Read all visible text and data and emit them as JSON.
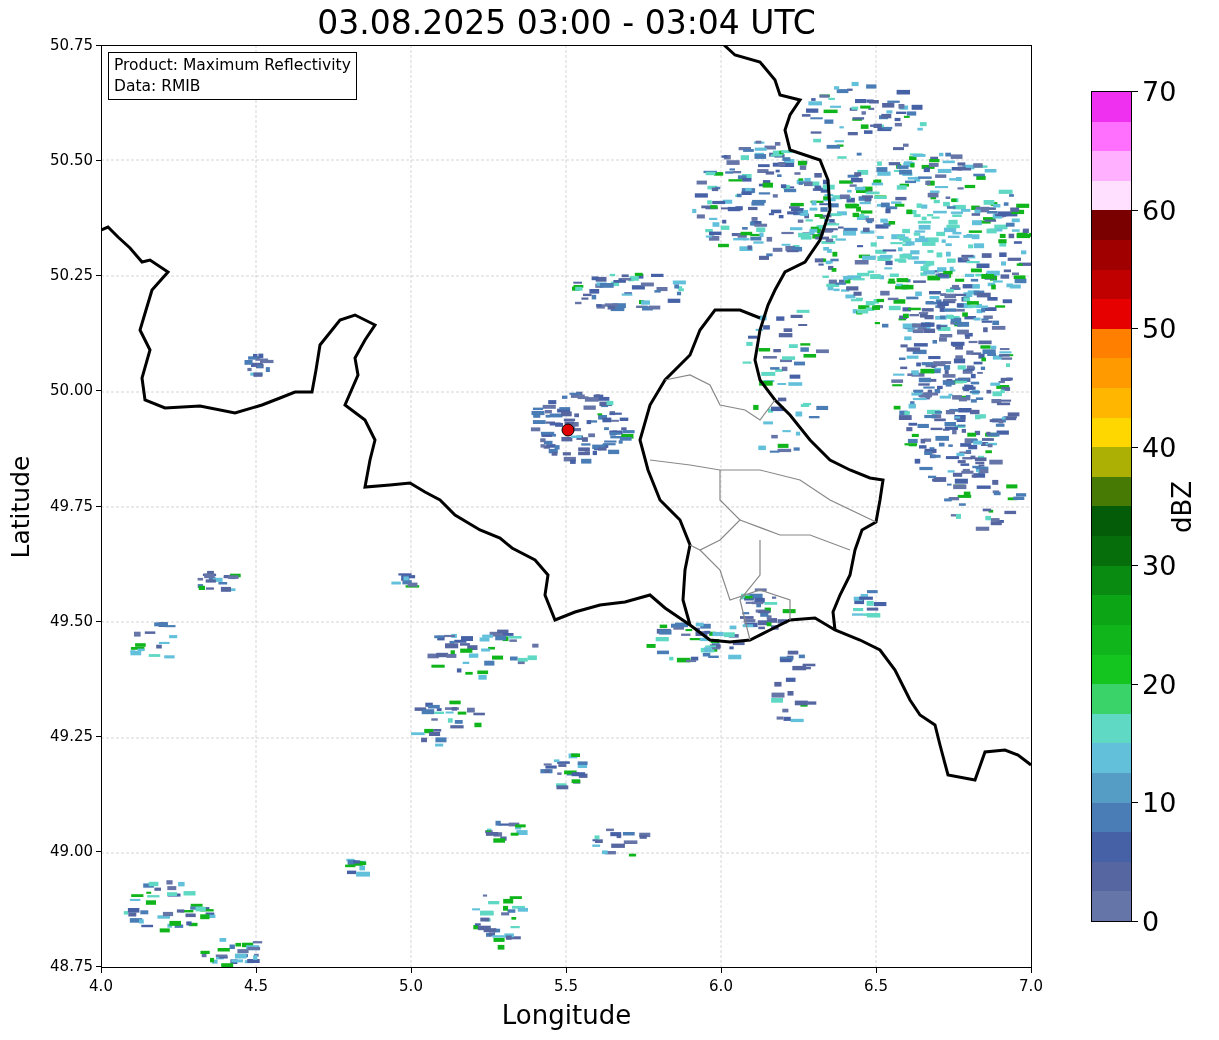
{
  "title": "03.08.2025 03:00 - 03:04 UTC",
  "info_box": {
    "lines": [
      "Product: Maximum Reflectivity",
      "Data: RMIB"
    ]
  },
  "map": {
    "x_axis": {
      "label": "Longitude",
      "ticks": [
        "4.0",
        "4.5",
        "5.0",
        "5.5",
        "6.0",
        "6.5",
        "7.0"
      ]
    },
    "y_axis": {
      "label": "Latitude",
      "ticks": [
        "50.75",
        "50.50",
        "50.25",
        "50.00",
        "49.75",
        "49.50",
        "49.25",
        "49.00",
        "48.75"
      ]
    }
  },
  "colorbar": {
    "label": "dBZ",
    "ticks": [
      "70",
      "60",
      "50",
      "40",
      "30",
      "20",
      "10",
      "0"
    ],
    "bands": [
      {
        "color": "#6675a8"
      },
      {
        "color": "#5566a0"
      },
      {
        "color": "#4761a6"
      },
      {
        "color": "#4a7db5"
      },
      {
        "color": "#559dc4"
      },
      {
        "color": "#62c0db"
      },
      {
        "color": "#5fd8c4"
      },
      {
        "color": "#3ad36a"
      },
      {
        "color": "#14c41f"
      },
      {
        "color": "#0fb51a"
      },
      {
        "color": "#0ca515"
      },
      {
        "color": "#098a10"
      },
      {
        "color": "#066f0b"
      },
      {
        "color": "#045c08"
      },
      {
        "color": "#467a04"
      },
      {
        "color": "#acaf04"
      },
      {
        "color": "#ffd700"
      },
      {
        "color": "#ffb600"
      },
      {
        "color": "#ff9a00"
      },
      {
        "color": "#ff7f00"
      },
      {
        "color": "#e60000"
      },
      {
        "color": "#c00000"
      },
      {
        "color": "#a00000"
      },
      {
        "color": "#7a0000"
      },
      {
        "color": "#ffe0ff"
      },
      {
        "color": "#ffb0ff"
      },
      {
        "color": "#ff70ff"
      },
      {
        "color": "#f030f0"
      }
    ]
  }
}
